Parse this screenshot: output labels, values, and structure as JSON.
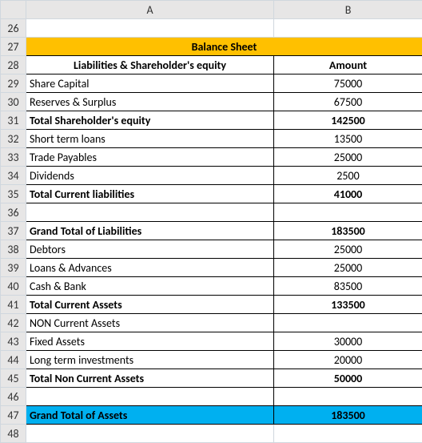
{
  "columns": {
    "A": "A",
    "B": "B"
  },
  "title": "Balance Sheet",
  "header": {
    "label": "Liabilities & Shareholder's equity",
    "amount": "Amount"
  },
  "rows": [
    {
      "num": "26",
      "label": "",
      "amount": "",
      "bold": false,
      "labelCenter": false,
      "fill": "none",
      "border": "none"
    },
    {
      "num": "27",
      "label": "Balance Sheet",
      "amount": "",
      "bold": true,
      "labelCenter": true,
      "fill": "title",
      "border": "all",
      "merge": true
    },
    {
      "num": "28",
      "label": "Liabilities & Shareholder's equity",
      "amount": "Amount",
      "bold": true,
      "labelCenter": true,
      "amountCenter": true,
      "fill": "none",
      "border": "all"
    },
    {
      "num": "29",
      "label": "Share Capital",
      "amount": "75000",
      "bold": false,
      "labelCenter": false,
      "amountCenter": true,
      "fill": "none",
      "border": "all"
    },
    {
      "num": "30",
      "label": "Reserves & Surplus",
      "amount": "67500",
      "bold": false,
      "labelCenter": false,
      "amountCenter": true,
      "fill": "none",
      "border": "all"
    },
    {
      "num": "31",
      "label": "Total Shareholder's equity",
      "amount": "142500",
      "bold": true,
      "labelCenter": false,
      "amountCenter": true,
      "fill": "none",
      "border": "all"
    },
    {
      "num": "32",
      "label": "Short term loans",
      "amount": "13500",
      "bold": false,
      "labelCenter": false,
      "amountCenter": true,
      "fill": "none",
      "border": "all"
    },
    {
      "num": "33",
      "label": "Trade Payables",
      "amount": "25000",
      "bold": false,
      "labelCenter": false,
      "amountCenter": true,
      "fill": "none",
      "border": "all"
    },
    {
      "num": "34",
      "label": "Dividends",
      "amount": "2500",
      "bold": false,
      "labelCenter": false,
      "amountCenter": true,
      "fill": "none",
      "border": "all"
    },
    {
      "num": "35",
      "label": "Total Current liabilities",
      "amount": "41000",
      "bold": true,
      "labelCenter": false,
      "amountCenter": true,
      "fill": "none",
      "border": "all"
    },
    {
      "num": "36",
      "label": "",
      "amount": "",
      "bold": false,
      "labelCenter": false,
      "fill": "none",
      "border": "all"
    },
    {
      "num": "37",
      "label": "Grand Total of Liabilities",
      "amount": "183500",
      "bold": true,
      "labelCenter": false,
      "amountCenter": true,
      "fill": "none",
      "border": "all"
    },
    {
      "num": "38",
      "label": "Debtors",
      "amount": "25000",
      "bold": false,
      "labelCenter": false,
      "amountCenter": true,
      "fill": "none",
      "border": "all"
    },
    {
      "num": "39",
      "label": "Loans & Advances",
      "amount": "25000",
      "bold": false,
      "labelCenter": false,
      "amountCenter": true,
      "fill": "none",
      "border": "all"
    },
    {
      "num": "40",
      "label": "Cash & Bank",
      "amount": "83500",
      "bold": false,
      "labelCenter": false,
      "amountCenter": true,
      "fill": "none",
      "border": "all"
    },
    {
      "num": "41",
      "label": "Total Current Assets",
      "amount": "133500",
      "bold": true,
      "labelCenter": false,
      "amountCenter": true,
      "fill": "none",
      "border": "all"
    },
    {
      "num": "42",
      "label": "NON Current Assets",
      "amount": "",
      "bold": false,
      "labelCenter": false,
      "amountCenter": true,
      "fill": "none",
      "border": "all"
    },
    {
      "num": "43",
      "label": "Fixed Assets",
      "amount": "30000",
      "bold": false,
      "labelCenter": false,
      "amountCenter": true,
      "fill": "none",
      "border": "all"
    },
    {
      "num": "44",
      "label": "Long term investments",
      "amount": "20000",
      "bold": false,
      "labelCenter": false,
      "amountCenter": true,
      "fill": "none",
      "border": "all"
    },
    {
      "num": "45",
      "label": "Total Non Current Assets",
      "amount": "50000",
      "bold": true,
      "labelCenter": false,
      "amountCenter": true,
      "fill": "none",
      "border": "all"
    },
    {
      "num": "46",
      "label": "",
      "amount": "",
      "bold": false,
      "labelCenter": false,
      "fill": "none",
      "border": "all"
    },
    {
      "num": "47",
      "label": "Grand Total of Assets",
      "amount": "183500",
      "bold": true,
      "labelCenter": false,
      "amountCenter": true,
      "fill": "grand",
      "border": "all"
    },
    {
      "num": "48",
      "label": "",
      "amount": "",
      "bold": false,
      "labelCenter": false,
      "fill": "none",
      "border": "none"
    }
  ]
}
